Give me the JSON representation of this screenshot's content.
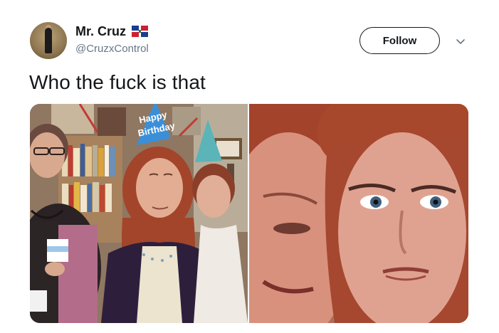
{
  "tweet": {
    "display_name": "Mr. Cruz",
    "handle": "@CruzxControl",
    "follow_label": "Follow",
    "text": "Who the fuck is that",
    "flag_icon": "dominican-republic-flag-icon",
    "chevron_icon": "chevron-down-icon"
  },
  "media": {
    "image_count": 2,
    "left_image_printed_text": "Happy Birthday",
    "colors": {
      "party_hat": "#3b8fd9",
      "hair": "#b5532c"
    }
  },
  "colors": {
    "text_primary": "#14171a",
    "text_secondary": "#657786",
    "background": "#ffffff"
  }
}
